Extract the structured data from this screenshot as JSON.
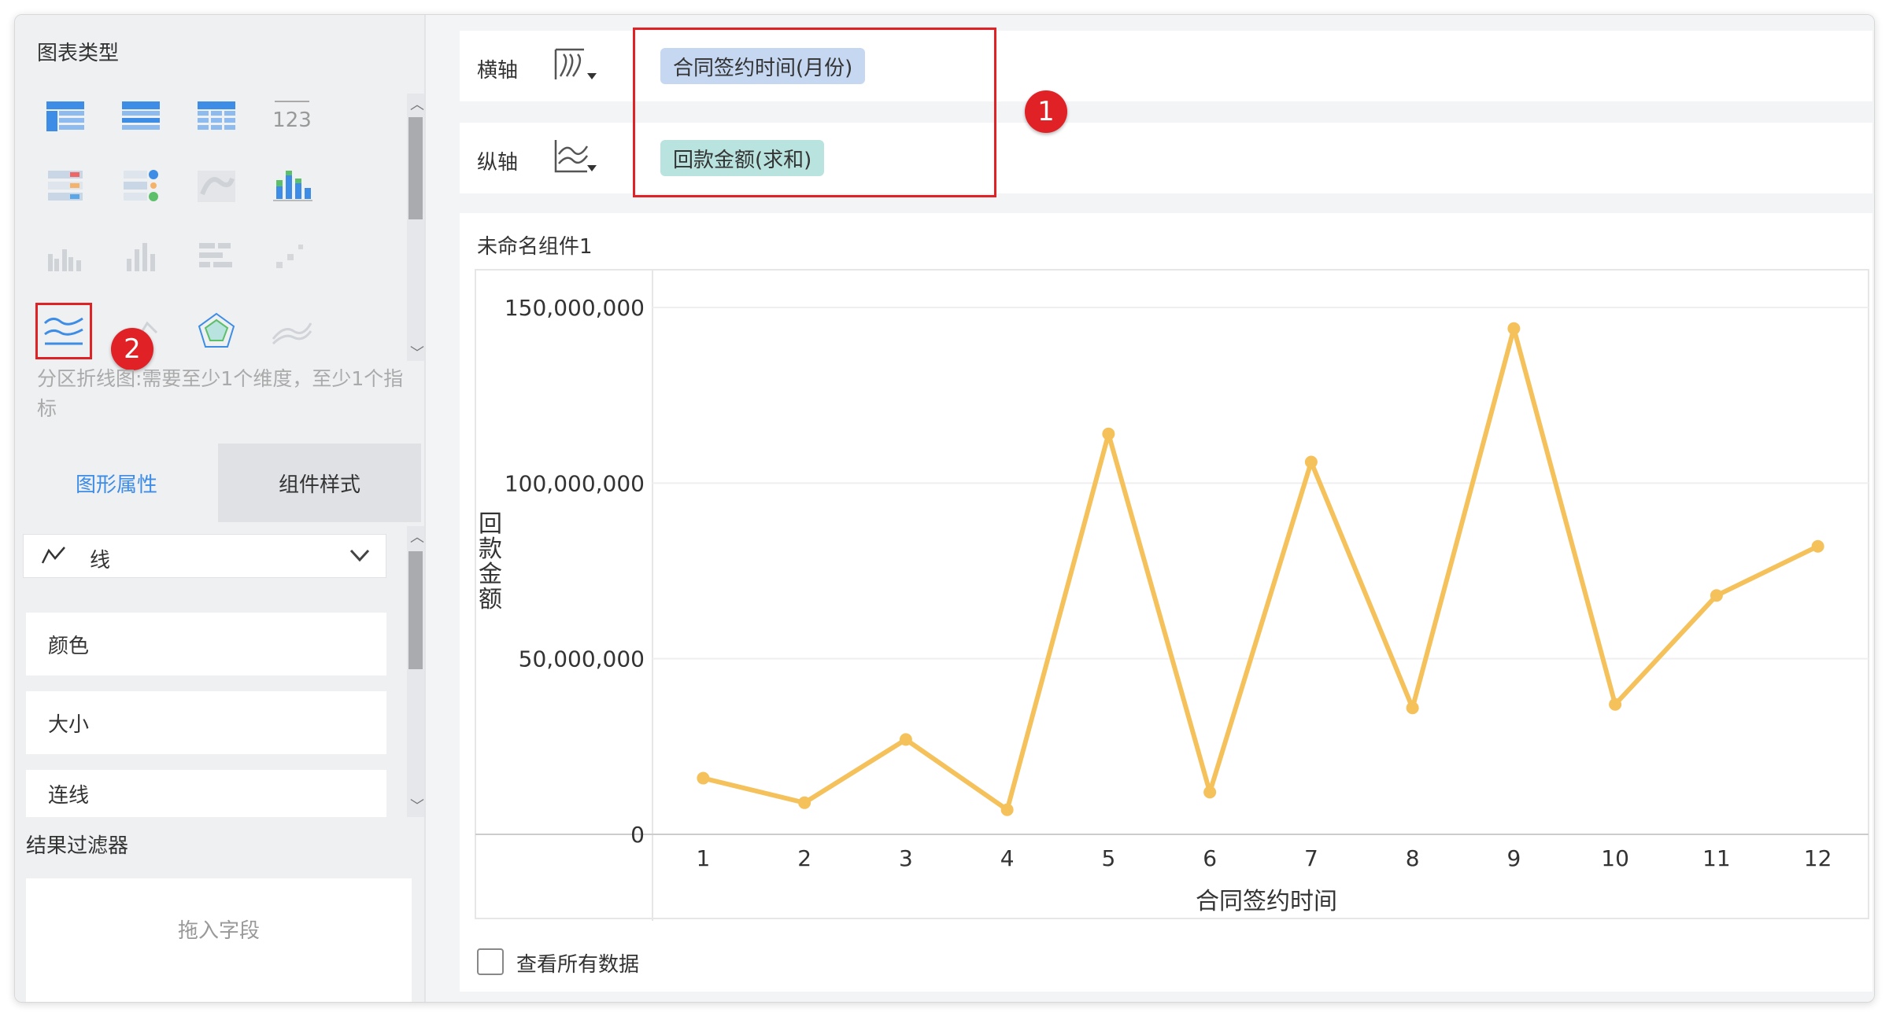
{
  "chart_types": {
    "title": "图表类型",
    "selected_hint": "分区折线图:需要至少1个维度，至少1个指标",
    "icons": [
      "cross-table-icon",
      "group-table-icon",
      "detail-table-icon",
      "number-text-icon",
      "multi-indicator-card-icon",
      "dot-indicator-icon",
      "heatmap-map-icon",
      "stacked-bar-icon",
      "multi-series-bar-icon",
      "bar-chart-icon",
      "horizontal-bar-icon",
      "scatter-icon",
      "area-line-chart-icon",
      "line-chart-icon",
      "radar-chart-icon",
      "stacked-area-icon"
    ],
    "number_icon_text": "123"
  },
  "tabs": {
    "shape": "图形属性",
    "style": "组件样式"
  },
  "properties": {
    "mark_type": "线",
    "items": [
      "颜色",
      "大小",
      "连线"
    ]
  },
  "filter": {
    "title": "结果过滤器",
    "placeholder": "拖入字段"
  },
  "axes": {
    "x_label": "横轴",
    "y_label": "纵轴",
    "x_field": "合同签约时间(月份)",
    "y_field": "回款金额(求和)"
  },
  "annotations": {
    "badge1": "1",
    "badge2": "2"
  },
  "component": {
    "title": "未命名组件1",
    "view_all": "查看所有数据"
  },
  "colors": {
    "accent": "#3d8ce6",
    "line": "#f5c15b",
    "highlight": "#e02126",
    "x_pill": "#c5d7f1",
    "y_pill": "#b9e3df"
  },
  "chart_data": {
    "type": "line",
    "categories": [
      "1",
      "2",
      "3",
      "4",
      "5",
      "6",
      "7",
      "8",
      "9",
      "10",
      "11",
      "12"
    ],
    "series": [
      {
        "values": [
          16000000,
          9000000,
          27000000,
          7000000,
          114000000,
          12000000,
          106000000,
          36000000,
          144000000,
          37000000,
          68000000,
          82000000
        ]
      }
    ],
    "xlabel": "合同签约时间",
    "ylabel": "回款金额",
    "ylim": [
      0,
      150000000
    ],
    "yticks": [
      "150,000,000",
      "100,000,000",
      "50,000,000",
      "0"
    ],
    "grid": true
  }
}
